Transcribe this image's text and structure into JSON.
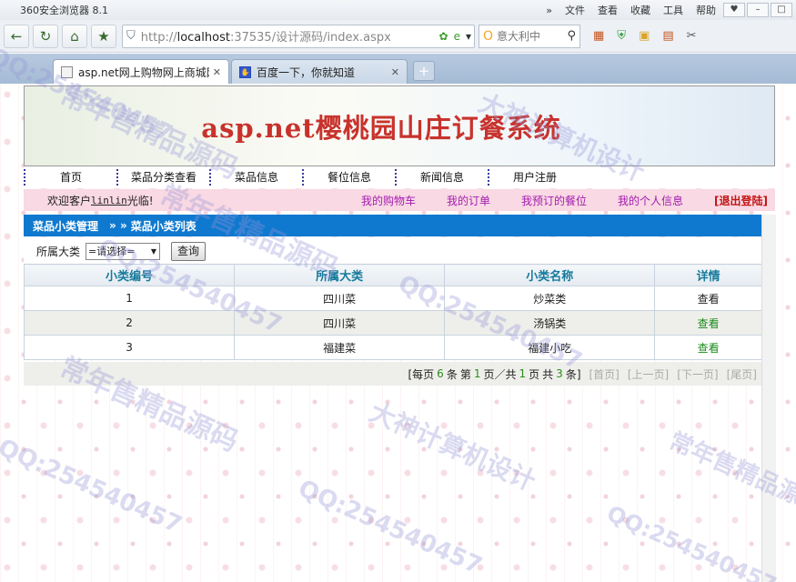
{
  "browser": {
    "title": "360安全浏览器 8.1",
    "menus": [
      "»",
      "文件",
      "查看",
      "收藏",
      "工具",
      "帮助"
    ],
    "address": {
      "prefix": "http://",
      "host": "localhost",
      "rest": ":37535/设计源码/index.aspx"
    },
    "search_text": "意大利中",
    "tabs": [
      {
        "label": "asp.net网上购物网上商城网站",
        "active": true
      },
      {
        "label": "百度一下，你就知道",
        "active": false
      }
    ]
  },
  "site": {
    "title": "asp.net樱桃园山庄订餐系统",
    "menu": [
      "首页",
      "菜品分类查看",
      "菜品信息",
      "餐位信息",
      "新闻信息",
      "用户注册"
    ],
    "welcome_prefix": "欢迎客户",
    "welcome_user": "linlin",
    "welcome_suffix": "光临!",
    "links": [
      "我的购物车",
      "我的订单",
      "我预订的餐位",
      "我的个人信息"
    ],
    "logout": "[退出登陆]",
    "section_left": "菜品小类管理",
    "section_sep": "» »",
    "section_right": "菜品小类列表",
    "filter_label": "所属大类",
    "filter_select": "=请选择=",
    "query_button": "查询"
  },
  "table": {
    "headers": [
      "小类编号",
      "所属大类",
      "小类名称",
      "详情"
    ],
    "rows": [
      {
        "id": "1",
        "major": "四川菜",
        "name": "炒菜类",
        "detail": "查看"
      },
      {
        "id": "2",
        "major": "四川菜",
        "name": "汤锅类",
        "detail": "查看"
      },
      {
        "id": "3",
        "major": "福建菜",
        "name": "福建小吃",
        "detail": "查看"
      }
    ]
  },
  "pager": {
    "per_page_prefix": "[每页",
    "per_page": "6",
    "per_page_suffix": "条",
    "page_prefix": "第",
    "current_page": "1",
    "page_mid": "页／共",
    "total_pages": "1",
    "page_suffix": "页",
    "total_prefix": "共",
    "total_records": "3",
    "total_suffix": "条]",
    "first": "[首页]",
    "prev": "[上一页]",
    "next": "[下一页]",
    "last": "[尾页]"
  },
  "watermarks": [
    "常年售精品源码",
    "QQ:254540457",
    "大神计算机设计"
  ]
}
